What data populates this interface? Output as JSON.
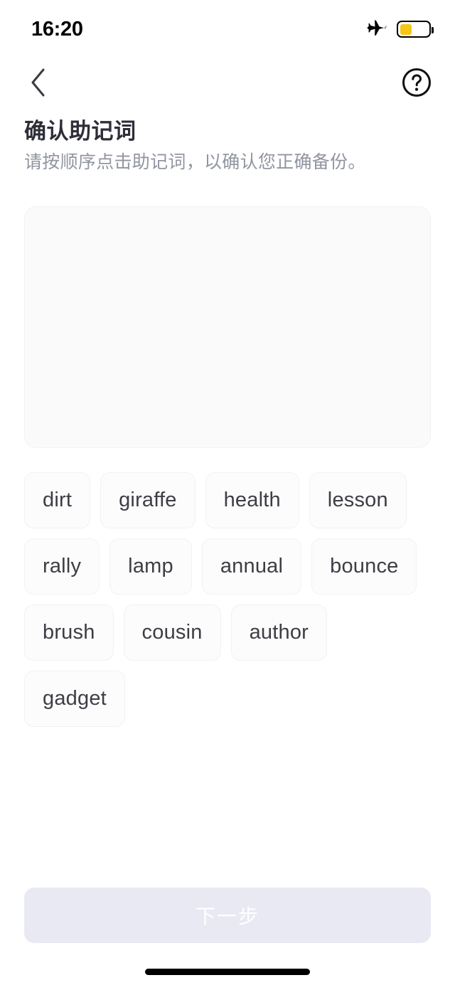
{
  "status_bar": {
    "time": "16:20",
    "airplane_icon": "airplane-icon",
    "battery_icon": "battery-icon",
    "battery_level_percent": 42,
    "battery_color": "#f5c518"
  },
  "nav_bar": {
    "back_icon": "chevron-left-icon",
    "help_icon": "question-mark-circle-icon"
  },
  "header": {
    "title": "确认助记词",
    "subtitle": "请按顺序点击助记词，以确认您正确备份。"
  },
  "answer_area": {
    "selected_words": [],
    "placeholder": ""
  },
  "word_bank": {
    "words": [
      "dirt",
      "giraffe",
      "health",
      "lesson",
      "rally",
      "lamp",
      "annual",
      "bounce",
      "brush",
      "cousin",
      "author",
      "gadget"
    ]
  },
  "footer": {
    "next_label": "下一步",
    "next_enabled": false
  },
  "colors": {
    "accent_disabled": "#e9e9f4",
    "chip_bg": "#fcfcfc",
    "answer_bg": "#fafafa",
    "title": "#2e2e38",
    "subtitle": "#9195a0"
  }
}
